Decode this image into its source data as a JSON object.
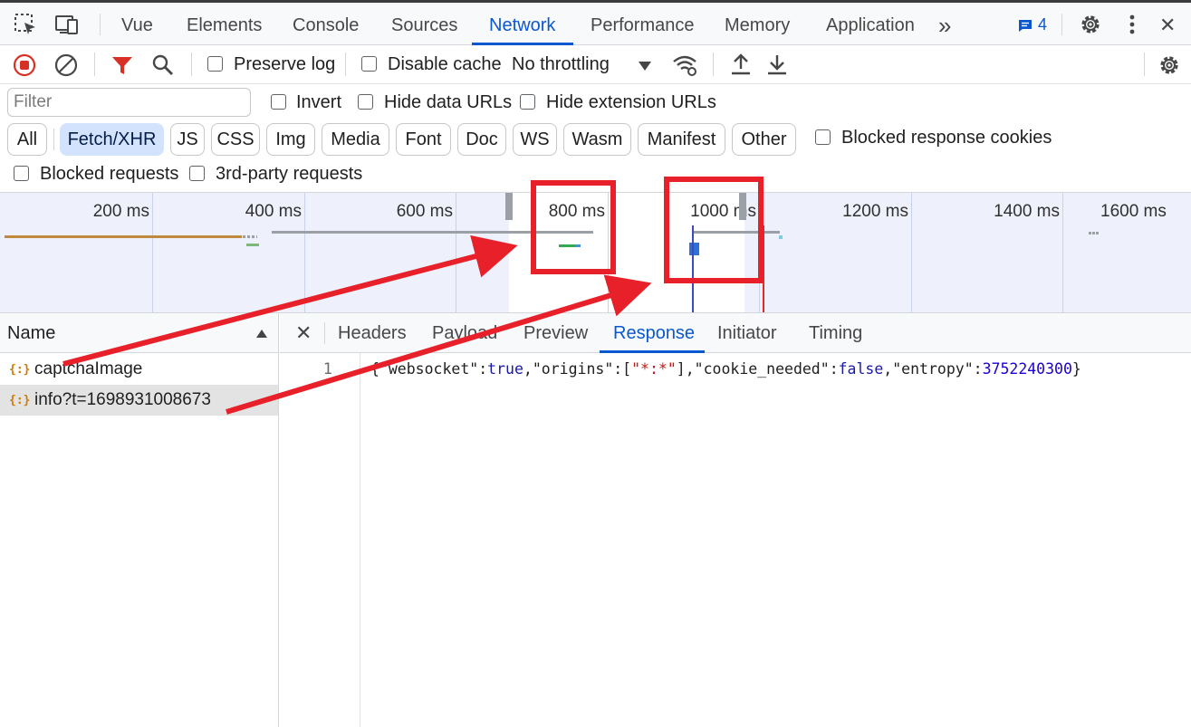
{
  "devtools": {
    "tabs": [
      {
        "label": "Vue"
      },
      {
        "label": "Elements"
      },
      {
        "label": "Console"
      },
      {
        "label": "Sources"
      },
      {
        "label": "Network"
      },
      {
        "label": "Performance"
      },
      {
        "label": "Memory"
      },
      {
        "label": "Application"
      }
    ],
    "active_tab": "Network",
    "more_tabs_glyph": "»",
    "message_count": "4",
    "close_glyph": "✕"
  },
  "toolbar": {
    "preserve_log": {
      "label": "Preserve log",
      "checked": false
    },
    "disable_cache": {
      "label": "Disable cache",
      "checked": false
    },
    "throttling": "No throttling"
  },
  "filter": {
    "placeholder": "Filter",
    "invert": {
      "label": "Invert",
      "checked": false
    },
    "hide_data_urls": {
      "label": "Hide data URLs",
      "checked": false
    },
    "hide_extension_urls": {
      "label": "Hide extension URLs",
      "checked": false
    },
    "types": [
      "All",
      "Fetch/XHR",
      "JS",
      "CSS",
      "Img",
      "Media",
      "Font",
      "Doc",
      "WS",
      "Wasm",
      "Manifest",
      "Other"
    ],
    "active_type": "Fetch/XHR",
    "blocked_response_cookies": {
      "label": "Blocked response cookies",
      "checked": false
    },
    "blocked_requests": {
      "label": "Blocked requests",
      "checked": false
    },
    "third_party_requests": {
      "label": "3rd-party requests",
      "checked": false
    }
  },
  "overview": {
    "ticks": [
      "200 ms",
      "400 ms",
      "600 ms",
      "800 ms",
      "1000 ms",
      "1200 ms",
      "1400 ms",
      "1600 ms"
    ]
  },
  "requests": {
    "column_name": "Name",
    "sort": "ascending",
    "rows": [
      {
        "name": "captchaImage",
        "selected": false
      },
      {
        "name": "info?t=1698931008673",
        "selected": true
      }
    ]
  },
  "detail": {
    "close_glyph": "✕",
    "tabs": [
      "Headers",
      "Payload",
      "Preview",
      "Response",
      "Initiator",
      "Timing"
    ],
    "active_tab": "Response",
    "line_number": "1",
    "response": {
      "open": "{",
      "k1": "\"websocket\"",
      "v1": "true",
      "k2": "\"origins\"",
      "v2": "\"*:*\"",
      "k3": "\"cookie_needed\"",
      "v3": "false",
      "k4": "\"entropy\"",
      "v4": "3752240300",
      "close": "}"
    }
  },
  "colors": {
    "accent": "#0b57d0",
    "annotation": "#e8202a",
    "record": "#d93025",
    "filter_icon": "#d93025"
  }
}
